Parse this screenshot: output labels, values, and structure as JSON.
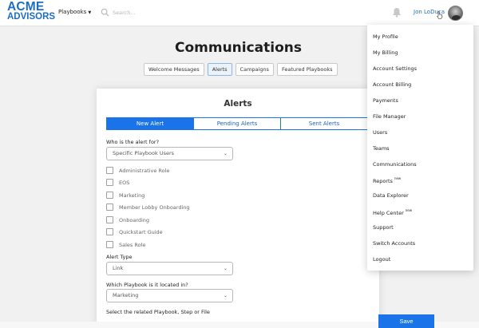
{
  "header": {
    "logo_line1": "ACME",
    "logo_line2": "ADVISORS",
    "nav_playbooks": "Playbooks",
    "search_placeholder": "Search...",
    "user_name": "Jon LoDuca"
  },
  "page": {
    "title": "Communications",
    "tabs": [
      "Welcome Messages",
      "Alerts",
      "Campaigns",
      "Featured Playbooks"
    ],
    "active_tab": "Alerts"
  },
  "card": {
    "title": "Alerts",
    "segments": [
      "New Alert",
      "Pending Alerts",
      "Sent Alerts"
    ],
    "active_segment": "New Alert",
    "who_label": "Who is the alert for?",
    "who_value": "Specific Playbook Users",
    "roles": [
      "Administrative Role",
      "EOS",
      "Marketing",
      "Member Lobby Onboarding",
      "Onboarding",
      "Quickstart Guide",
      "Sales Role"
    ],
    "alert_type_label": "Alert Type",
    "alert_type_value": "Link",
    "playbook_label": "Which Playbook is it located in?",
    "playbook_value": "Marketing",
    "related_label": "Select the related Playbook, Step or File"
  },
  "menu": {
    "items": [
      "My Profile",
      "My Billing",
      "Account Settings",
      "Account Billing",
      "Payments",
      "File Manager",
      "Users",
      "Teams",
      "Communications",
      "Reports",
      "Data Explorer",
      "Help Center",
      "Support",
      "Switch Accounts",
      "Logout"
    ],
    "new_badge": "new"
  },
  "actions": {
    "save_label": "Save"
  },
  "colors": {
    "brand": "#1b6ec2",
    "primary": "#1a73e8"
  }
}
